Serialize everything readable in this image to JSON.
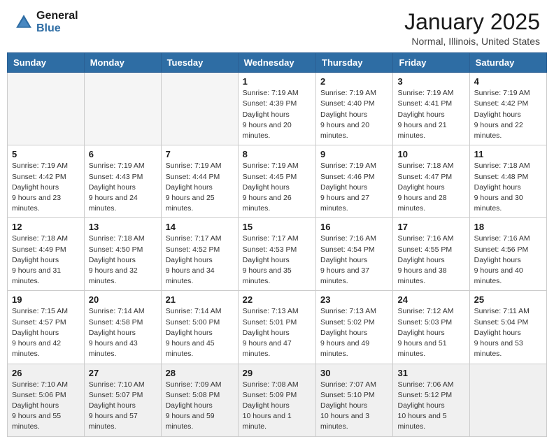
{
  "logo": {
    "general": "General",
    "blue": "Blue"
  },
  "header": {
    "month": "January 2025",
    "location": "Normal, Illinois, United States"
  },
  "days_of_week": [
    "Sunday",
    "Monday",
    "Tuesday",
    "Wednesday",
    "Thursday",
    "Friday",
    "Saturday"
  ],
  "weeks": [
    [
      {
        "day": "",
        "empty": true
      },
      {
        "day": "",
        "empty": true
      },
      {
        "day": "",
        "empty": true
      },
      {
        "day": "1",
        "sunrise": "7:19 AM",
        "sunset": "4:39 PM",
        "daylight": "9 hours and 20 minutes."
      },
      {
        "day": "2",
        "sunrise": "7:19 AM",
        "sunset": "4:40 PM",
        "daylight": "9 hours and 20 minutes."
      },
      {
        "day": "3",
        "sunrise": "7:19 AM",
        "sunset": "4:41 PM",
        "daylight": "9 hours and 21 minutes."
      },
      {
        "day": "4",
        "sunrise": "7:19 AM",
        "sunset": "4:42 PM",
        "daylight": "9 hours and 22 minutes."
      }
    ],
    [
      {
        "day": "5",
        "sunrise": "7:19 AM",
        "sunset": "4:42 PM",
        "daylight": "9 hours and 23 minutes."
      },
      {
        "day": "6",
        "sunrise": "7:19 AM",
        "sunset": "4:43 PM",
        "daylight": "9 hours and 24 minutes."
      },
      {
        "day": "7",
        "sunrise": "7:19 AM",
        "sunset": "4:44 PM",
        "daylight": "9 hours and 25 minutes."
      },
      {
        "day": "8",
        "sunrise": "7:19 AM",
        "sunset": "4:45 PM",
        "daylight": "9 hours and 26 minutes."
      },
      {
        "day": "9",
        "sunrise": "7:19 AM",
        "sunset": "4:46 PM",
        "daylight": "9 hours and 27 minutes."
      },
      {
        "day": "10",
        "sunrise": "7:18 AM",
        "sunset": "4:47 PM",
        "daylight": "9 hours and 28 minutes."
      },
      {
        "day": "11",
        "sunrise": "7:18 AM",
        "sunset": "4:48 PM",
        "daylight": "9 hours and 30 minutes."
      }
    ],
    [
      {
        "day": "12",
        "sunrise": "7:18 AM",
        "sunset": "4:49 PM",
        "daylight": "9 hours and 31 minutes."
      },
      {
        "day": "13",
        "sunrise": "7:18 AM",
        "sunset": "4:50 PM",
        "daylight": "9 hours and 32 minutes."
      },
      {
        "day": "14",
        "sunrise": "7:17 AM",
        "sunset": "4:52 PM",
        "daylight": "9 hours and 34 minutes."
      },
      {
        "day": "15",
        "sunrise": "7:17 AM",
        "sunset": "4:53 PM",
        "daylight": "9 hours and 35 minutes."
      },
      {
        "day": "16",
        "sunrise": "7:16 AM",
        "sunset": "4:54 PM",
        "daylight": "9 hours and 37 minutes."
      },
      {
        "day": "17",
        "sunrise": "7:16 AM",
        "sunset": "4:55 PM",
        "daylight": "9 hours and 38 minutes."
      },
      {
        "day": "18",
        "sunrise": "7:16 AM",
        "sunset": "4:56 PM",
        "daylight": "9 hours and 40 minutes."
      }
    ],
    [
      {
        "day": "19",
        "sunrise": "7:15 AM",
        "sunset": "4:57 PM",
        "daylight": "9 hours and 42 minutes."
      },
      {
        "day": "20",
        "sunrise": "7:14 AM",
        "sunset": "4:58 PM",
        "daylight": "9 hours and 43 minutes."
      },
      {
        "day": "21",
        "sunrise": "7:14 AM",
        "sunset": "5:00 PM",
        "daylight": "9 hours and 45 minutes."
      },
      {
        "day": "22",
        "sunrise": "7:13 AM",
        "sunset": "5:01 PM",
        "daylight": "9 hours and 47 minutes."
      },
      {
        "day": "23",
        "sunrise": "7:13 AM",
        "sunset": "5:02 PM",
        "daylight": "9 hours and 49 minutes."
      },
      {
        "day": "24",
        "sunrise": "7:12 AM",
        "sunset": "5:03 PM",
        "daylight": "9 hours and 51 minutes."
      },
      {
        "day": "25",
        "sunrise": "7:11 AM",
        "sunset": "5:04 PM",
        "daylight": "9 hours and 53 minutes."
      }
    ],
    [
      {
        "day": "26",
        "sunrise": "7:10 AM",
        "sunset": "5:06 PM",
        "daylight": "9 hours and 55 minutes.",
        "last": true
      },
      {
        "day": "27",
        "sunrise": "7:10 AM",
        "sunset": "5:07 PM",
        "daylight": "9 hours and 57 minutes.",
        "last": true
      },
      {
        "day": "28",
        "sunrise": "7:09 AM",
        "sunset": "5:08 PM",
        "daylight": "9 hours and 59 minutes.",
        "last": true
      },
      {
        "day": "29",
        "sunrise": "7:08 AM",
        "sunset": "5:09 PM",
        "daylight": "10 hours and 1 minute.",
        "last": true
      },
      {
        "day": "30",
        "sunrise": "7:07 AM",
        "sunset": "5:10 PM",
        "daylight": "10 hours and 3 minutes.",
        "last": true
      },
      {
        "day": "31",
        "sunrise": "7:06 AM",
        "sunset": "5:12 PM",
        "daylight": "10 hours and 5 minutes.",
        "last": true
      },
      {
        "day": "",
        "empty": true,
        "last": true
      }
    ]
  ]
}
